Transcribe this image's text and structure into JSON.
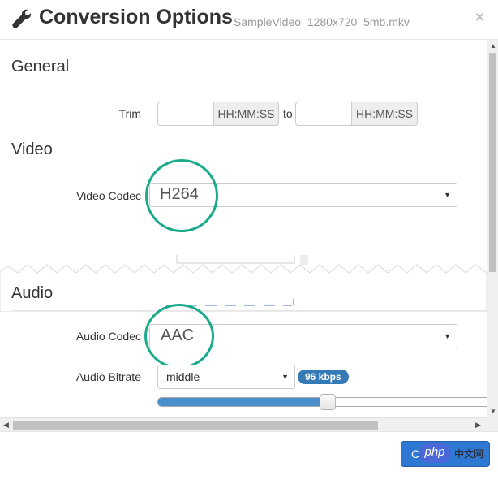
{
  "dialog": {
    "title": "Conversion Options",
    "filename": "SampleVideo_1280x720_5mb.mkv",
    "close_symbol": "×"
  },
  "general": {
    "heading": "General",
    "trim_label": "Trim",
    "trim_start_value": "",
    "trim_start_addon": "HH:MM:SS",
    "trim_to": "to",
    "trim_end_value": "",
    "trim_end_addon": "HH:MM:SS"
  },
  "video": {
    "heading": "Video",
    "codec_label": "Video Codec",
    "codec_value": "H264"
  },
  "audio": {
    "heading": "Audio",
    "codec_label": "Audio Codec",
    "codec_value": "AAC",
    "bitrate_label": "Audio Bitrate",
    "bitrate_value": "middle",
    "bitrate_badge": "96 kbps",
    "bitrate_slider_fraction": 0.5
  },
  "footer": {
    "ok_button_text": "C"
  },
  "watermark": {
    "php": "php",
    "cn": "中文网"
  },
  "icons": {
    "title_icon": "wrench-icon",
    "select_caret": "caret-down-icon",
    "scroll_up": "triangle-up-icon",
    "scroll_down": "triangle-down-icon",
    "scroll_left": "triangle-left-icon",
    "scroll_right": "triangle-right-icon"
  },
  "colors": {
    "highlight_circle": "#1aaa8c",
    "badge": "#337ab7",
    "slider_fill": "#4a8fcb",
    "primary_button": "#2e78d4"
  }
}
